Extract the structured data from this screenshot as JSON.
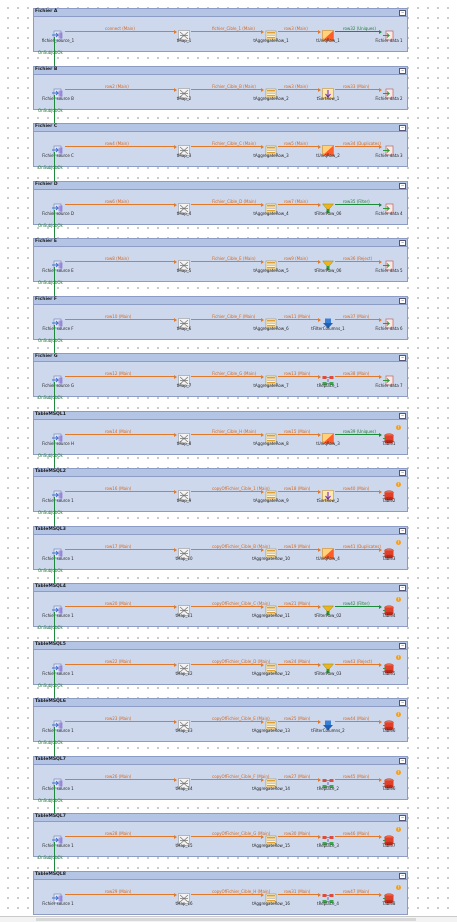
{
  "canvas": {
    "subjobs": [
      {
        "title": "Fichier A",
        "source_label": "fichier_source_1",
        "flow1": "connect (Main)",
        "map_label": "tMap_1",
        "flow2": "fichier_Cible_1 (Main)",
        "agg_label": "tAggregateRow_1",
        "flow3": "row3 (Main)",
        "proc_label": "tUniqRow_1",
        "proc_icon": "uniq-icon",
        "flow4": "row32 (Uniques)",
        "out_label": "Fichier data 1",
        "out_icon": "file-output-icon"
      },
      {
        "title": "Fichier B",
        "source_label": "Fichier source B",
        "flow1": "row2 (Main)",
        "map_label": "tMap_2",
        "flow2": "Fichier_Cible_B (Main)",
        "agg_label": "tAggregateRow_2",
        "flow3": "row3 (Main)",
        "proc_label": "tSortRow_1",
        "proc_icon": "sort-icon",
        "flow4": "row33 (Main)",
        "out_label": "Fichier data 2",
        "out_icon": "file-output-icon"
      },
      {
        "title": "Fichier C",
        "source_label": "Fichier source C",
        "flow1": "row4 (Main)",
        "map_label": "tMap_3",
        "flow2": "Fichier_Cible_C (Main)",
        "agg_label": "tAggregateRow_3",
        "flow3": "row5 (Main)",
        "proc_label": "tUniqRow_2",
        "proc_icon": "uniq-icon",
        "flow4": "row34 (Duplicates)",
        "out_label": "Fichier data 3",
        "out_icon": "file-output-icon"
      },
      {
        "title": "Fichier D",
        "source_label": "Fichier source D",
        "flow1": "row6 (Main)",
        "map_label": "tMap_4",
        "flow2": "Fichier_Cible_D (Main)",
        "agg_label": "tAggregateRow_4",
        "flow3": "row7 (Main)",
        "proc_label": "tFilterRow_06",
        "proc_icon": "filter-icon",
        "flow4": "row35 (Filter)",
        "out_label": "Fichier data 4",
        "out_icon": "file-output-icon"
      },
      {
        "title": "Fichier E",
        "source_label": "Fichier source E",
        "flow1": "row8 (Main)",
        "map_label": "tMap_5",
        "flow2": "Fichier_Cible_E (Main)",
        "agg_label": "tAggregateRow_5",
        "flow3": "row9 (Main)",
        "proc_label": "tFilterRow_06",
        "proc_icon": "filter-icon",
        "flow4": "row36 (Reject)",
        "out_label": "Fichier data 5",
        "out_icon": "file-output-icon"
      },
      {
        "title": "Fichier F",
        "source_label": "Fichier source F",
        "flow1": "row10 (Main)",
        "map_label": "tMap_6",
        "flow2": "Fichier_Cible_F (Main)",
        "agg_label": "tAggregateRow_6",
        "flow3": "row11 (Main)",
        "proc_label": "tFilterColumns_1",
        "proc_icon": "filter-columns-icon",
        "flow4": "row37 (Main)",
        "out_label": "Fichier data 6",
        "out_icon": "file-output-icon"
      },
      {
        "title": "Fichier G",
        "source_label": "Fichier source G",
        "flow1": "row12 (Main)",
        "map_label": "tMap_7",
        "flow2": "Fichier_Cible_G (Main)",
        "agg_label": "tAggregateRow_7",
        "flow3": "row13 (Main)",
        "proc_label": "tReplace_1",
        "proc_icon": "replace-icon",
        "flow4": "row38 (Main)",
        "out_label": "Fichier data 7",
        "out_icon": "file-output-icon"
      },
      {
        "title": "TableMSQL1",
        "source_label": "Fichier source H",
        "flow1": "row14 (Main)",
        "map_label": "tMap_8",
        "flow2": "Fichier_Cible_H (Main)",
        "agg_label": "tAggregateRow_8",
        "flow3": "row15 (Main)",
        "proc_label": "tUniqRow_3",
        "proc_icon": "uniq-icon",
        "flow4": "row39 (Uniques)",
        "out_label": "Table1",
        "out_icon": "db-output-icon"
      },
      {
        "title": "TableMSQL2",
        "source_label": "Fichier source 1",
        "flow1": "row16 (Main)",
        "map_label": "tMap_9",
        "flow2": "copyOfFichier_Cible_1 (Main)",
        "agg_label": "tAggregateRow_9",
        "flow3": "row18 (Main)",
        "proc_label": "tSortRow_2",
        "proc_icon": "sort-icon",
        "flow4": "row40 (Main)",
        "out_label": "Table2",
        "out_icon": "db-output-icon"
      },
      {
        "title": "TableMSQL3",
        "source_label": "Fichier source 1",
        "flow1": "row17 (Main)",
        "map_label": "tMap_10",
        "flow2": "copyOfFichier_Cible_B (Main)",
        "agg_label": "tAggregateRow_10",
        "flow3": "row19 (Main)",
        "proc_label": "tUniqRow_4",
        "proc_icon": "uniq-icon",
        "flow4": "row41 (Duplicates)",
        "out_label": "Table3",
        "out_icon": "db-output-icon"
      },
      {
        "title": "TableMSQL4",
        "source_label": "Fichier source 1",
        "flow1": "row20 (Main)",
        "map_label": "tMap_11",
        "flow2": "copyOfFichier_Cible_C (Main)",
        "agg_label": "tAggregateRow_11",
        "flow3": "row21 (Main)",
        "proc_label": "tFilterRow_02",
        "proc_icon": "filter-icon",
        "flow4": "row42 (Filter)",
        "out_label": "Table4",
        "out_icon": "db-output-icon"
      },
      {
        "title": "TableMSQL5",
        "source_label": "Fichier source 1",
        "flow1": "row22 (Main)",
        "map_label": "tMap_12",
        "flow2": "copyOfFichier_Cible_D (Main)",
        "agg_label": "tAggregateRow_12",
        "flow3": "row24 (Main)",
        "proc_label": "tFilterRow_03",
        "proc_icon": "filter-icon",
        "flow4": "row43 (Reject)",
        "out_label": "Table5",
        "out_icon": "db-output-icon"
      },
      {
        "title": "TableMSQL6",
        "source_label": "Fichier source 1",
        "flow1": "row23 (Main)",
        "map_label": "tMap_13",
        "flow2": "copyOfFichier_Cible_E (Main)",
        "agg_label": "tAggregateRow_13",
        "flow3": "row25 (Main)",
        "proc_label": "tFilterColumns_2",
        "proc_icon": "filter-columns-icon",
        "flow4": "row44 (Main)",
        "out_label": "Table6",
        "out_icon": "db-output-icon"
      },
      {
        "title": "TableMSQL7",
        "source_label": "Fichier source 1",
        "flow1": "row26 (Main)",
        "map_label": "tMap_14",
        "flow2": "copyOfFichier_Cible_F (Main)",
        "agg_label": "tAggregateRow_14",
        "flow3": "row27 (Main)",
        "proc_label": "tReplace_2",
        "proc_icon": "replace-icon",
        "flow4": "row45 (Main)",
        "out_label": "Table6",
        "out_icon": "db-output-icon"
      },
      {
        "title": "TableMSQL7",
        "source_label": "Fichier source 1",
        "flow1": "row28 (Main)",
        "map_label": "tMap_15",
        "flow2": "copyOfFichier_Cible_G (Main)",
        "agg_label": "tAggregateRow_15",
        "flow3": "row30 (Main)",
        "proc_label": "tReplace_3",
        "proc_icon": "replace-icon",
        "flow4": "row46 (Main)",
        "out_label": "Table7",
        "out_icon": "db-output-icon"
      },
      {
        "title": "TableMSQL8",
        "source_label": "Fichier source 1",
        "flow1": "row29 (Main)",
        "map_label": "tMap_16",
        "flow2": "copyOfFichier_Cible_H (Main)",
        "agg_label": "tAggregateRow_16",
        "flow3": "row31 (Main)",
        "proc_label": "tReplace_4",
        "proc_icon": "replace-icon",
        "flow4": "row47 (Main)",
        "out_label": "Table8",
        "out_icon": "db-output-icon"
      }
    ],
    "trigger_label": "OnSubjobOk",
    "collapse_symbol": "−",
    "warning_symbol": "!",
    "colors": {
      "subjob_bg": "#cdd8ec",
      "subjob_header": "#b3c4e4",
      "main_flow": "#e07a2a",
      "trigger_flow": "#1f8a3c"
    }
  }
}
